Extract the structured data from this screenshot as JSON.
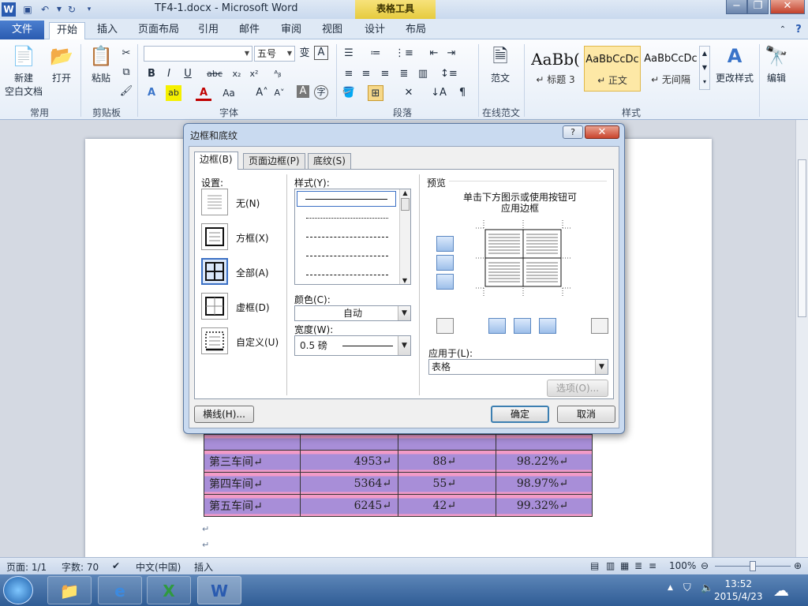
{
  "titlebar": {
    "doc_title": "TF4-1.docx - Microsoft Word",
    "table_tools_tab": "表格工具",
    "minimize_glyph": "−",
    "restore_glyph": "❐",
    "close_glyph": "✕"
  },
  "ribbon_tabs": {
    "file": "文件",
    "home": "开始",
    "insert": "插入",
    "page_layout": "页面布局",
    "references": "引用",
    "mailings": "邮件",
    "review": "审阅",
    "view": "视图",
    "design": "设计",
    "layout": "布局"
  },
  "ribbon": {
    "new_blank": "新建",
    "new_blank_line2": "空白文档",
    "open": "打开",
    "paste": "粘贴",
    "group_common": "常用",
    "group_clipboard": "剪贴板",
    "group_font": "字体",
    "group_paragraph": "段落",
    "group_online_template": "在线范文",
    "group_styles": "样式",
    "font_name_value": "",
    "font_size_value": "五号",
    "template": "范文",
    "change_styles": "更改样式",
    "edit": "编辑",
    "styles": [
      {
        "sample": "AaBb(",
        "name": "↵ 标题 3"
      },
      {
        "sample": "AaBbCcDc",
        "name": "↵ 正文"
      },
      {
        "sample": "AaBbCcDc",
        "name": "↵ 无间隔"
      }
    ]
  },
  "document": {
    "rows": [
      {
        "name": "第三车间↵",
        "v1": "4953↵",
        "v2": "88↵",
        "v3": "98.22%↵"
      },
      {
        "name": "第四车间↵",
        "v1": "5364↵",
        "v2": "55↵",
        "v3": "98.97%↵"
      },
      {
        "name": "第五车间↵",
        "v1": "6245↵",
        "v2": "42↵",
        "v3": "99.32%↵"
      }
    ],
    "para_mark": "↵"
  },
  "dialog": {
    "title": "边框和底纹",
    "help": "?",
    "close": "✕",
    "tabs": {
      "border": "边框(B)",
      "page_border": "页面边框(P)",
      "shading": "底纹(S)"
    },
    "settings_label": "设置:",
    "settings": {
      "none": "无(N)",
      "box": "方框(X)",
      "all": "全部(A)",
      "grid": "虚框(D)",
      "custom": "自定义(U)"
    },
    "style_label": "样式(Y):",
    "color_label": "颜色(C):",
    "color_value": "自动",
    "width_label": "宽度(W):",
    "width_value": "0.5 磅",
    "preview_label": "预览",
    "preview_hint_1": "单击下方图示或使用按钮可",
    "preview_hint_2": "应用边框",
    "apply_label": "应用于(L):",
    "apply_value": "表格",
    "options_btn": "选项(O)...",
    "hline_btn": "横线(H)...",
    "ok_btn": "确定",
    "cancel_btn": "取消"
  },
  "statusbar": {
    "page": "页面: 1/1",
    "words": "字数: 70",
    "language": "中文(中国)",
    "insert_mode": "插入",
    "zoom": "100%"
  },
  "taskbar": {
    "time": "13:52",
    "date": "2015/4/23"
  }
}
